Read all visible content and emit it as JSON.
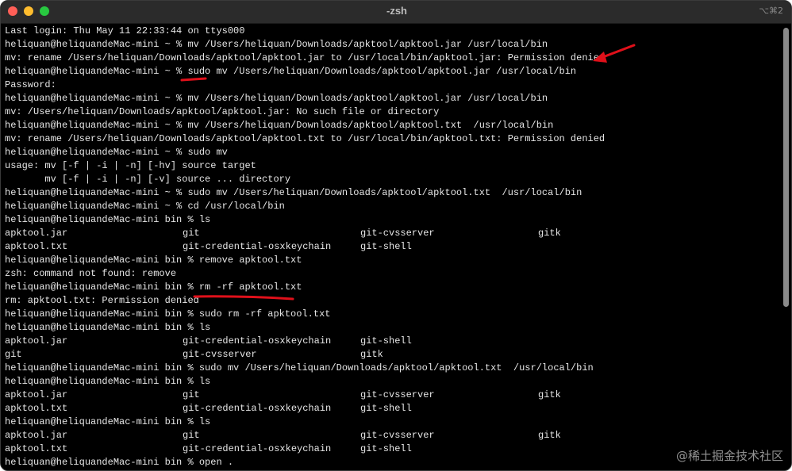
{
  "window": {
    "title": "-zsh",
    "shortcut": "⌥⌘2"
  },
  "terminal": {
    "lines": [
      "Last login: Thu May 11 22:33:44 on ttys000",
      "heliquan@heliquandeMac-mini ~ % mv /Users/heliquan/Downloads/apktool/apktool.jar /usr/local/bin",
      "mv: rename /Users/heliquan/Downloads/apktool/apktool.jar to /usr/local/bin/apktool.jar: Permission denied",
      "heliquan@heliquandeMac-mini ~ % sudo mv /Users/heliquan/Downloads/apktool/apktool.jar /usr/local/bin",
      "Password:",
      "heliquan@heliquandeMac-mini ~ % mv /Users/heliquan/Downloads/apktool/apktool.jar /usr/local/bin",
      "mv: /Users/heliquan/Downloads/apktool/apktool.jar: No such file or directory",
      "heliquan@heliquandeMac-mini ~ % mv /Users/heliquan/Downloads/apktool/apktool.txt  /usr/local/bin",
      "mv: rename /Users/heliquan/Downloads/apktool/apktool.txt to /usr/local/bin/apktool.txt: Permission denied",
      "heliquan@heliquandeMac-mini ~ % sudo mv",
      "usage: mv [-f | -i | -n] [-hv] source target",
      "       mv [-f | -i | -n] [-v] source ... directory",
      "heliquan@heliquandeMac-mini ~ % sudo mv /Users/heliquan/Downloads/apktool/apktool.txt  /usr/local/bin",
      "heliquan@heliquandeMac-mini ~ % cd /usr/local/bin",
      "heliquan@heliquandeMac-mini bin % ls"
    ],
    "ls1": [
      [
        "apktool.jar",
        "git",
        "git-cvsserver",
        "gitk"
      ],
      [
        "apktool.txt",
        "git-credential-osxkeychain",
        "git-shell",
        ""
      ]
    ],
    "lines2": [
      "heliquan@heliquandeMac-mini bin % remove apktool.txt",
      "zsh: command not found: remove",
      "heliquan@heliquandeMac-mini bin % rm -rf apktool.txt",
      "rm: apktool.txt: Permission denied",
      "heliquan@heliquandeMac-mini bin % sudo rm -rf apktool.txt",
      "heliquan@heliquandeMac-mini bin % ls"
    ],
    "ls2": [
      [
        "apktool.jar",
        "git-credential-osxkeychain",
        "git-shell",
        ""
      ],
      [
        "git",
        "git-cvsserver",
        "gitk",
        ""
      ]
    ],
    "lines3": [
      "heliquan@heliquandeMac-mini bin % sudo mv /Users/heliquan/Downloads/apktool/apktool.txt  /usr/local/bin",
      "heliquan@heliquandeMac-mini bin % ls"
    ],
    "ls3": [
      [
        "apktool.jar",
        "git",
        "git-cvsserver",
        "gitk"
      ],
      [
        "apktool.txt",
        "git-credential-osxkeychain",
        "git-shell",
        ""
      ]
    ],
    "lines4": [
      "heliquan@heliquandeMac-mini bin % ls"
    ],
    "ls4": [
      [
        "apktool.jar",
        "git",
        "git-cvsserver",
        "gitk"
      ],
      [
        "apktool.txt",
        "git-credential-osxkeychain",
        "git-shell",
        ""
      ]
    ],
    "lines5": [
      "heliquan@heliquandeMac-mini bin % open ."
    ]
  },
  "watermark": "@稀土掘金技术社区",
  "colors": {
    "annotation": "#e0101a",
    "background": "#000000",
    "text": "#e6e6e6"
  }
}
